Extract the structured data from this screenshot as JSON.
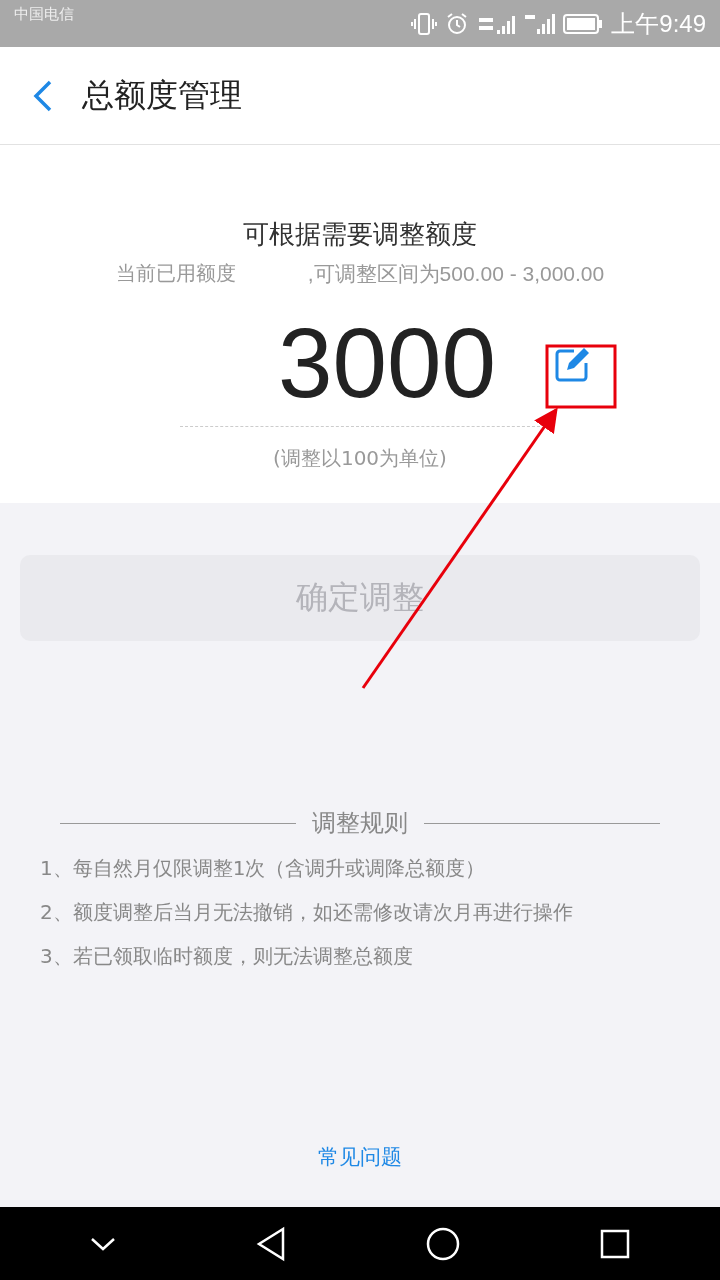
{
  "status_bar": {
    "carrier": "中国电信",
    "time": "上午9:49"
  },
  "header": {
    "title": "总额度管理"
  },
  "adjust": {
    "heading": "可根据需要调整额度",
    "used_label": "当前已用额度",
    "range": ",可调整区间为500.00 - 3,000.00",
    "amount": "3000",
    "unit_hint": "(调整以100为单位)"
  },
  "confirm_button": {
    "label": "确定调整",
    "disabled": true
  },
  "rules": {
    "title": "调整规则",
    "items": [
      "1、每自然月仅限调整1次（含调升或调降总额度）",
      "2、额度调整后当月无法撤销，如还需修改请次月再进行操作",
      "3、若已领取临时额度，则无法调整总额度"
    ]
  },
  "faq_link": "常见问题"
}
